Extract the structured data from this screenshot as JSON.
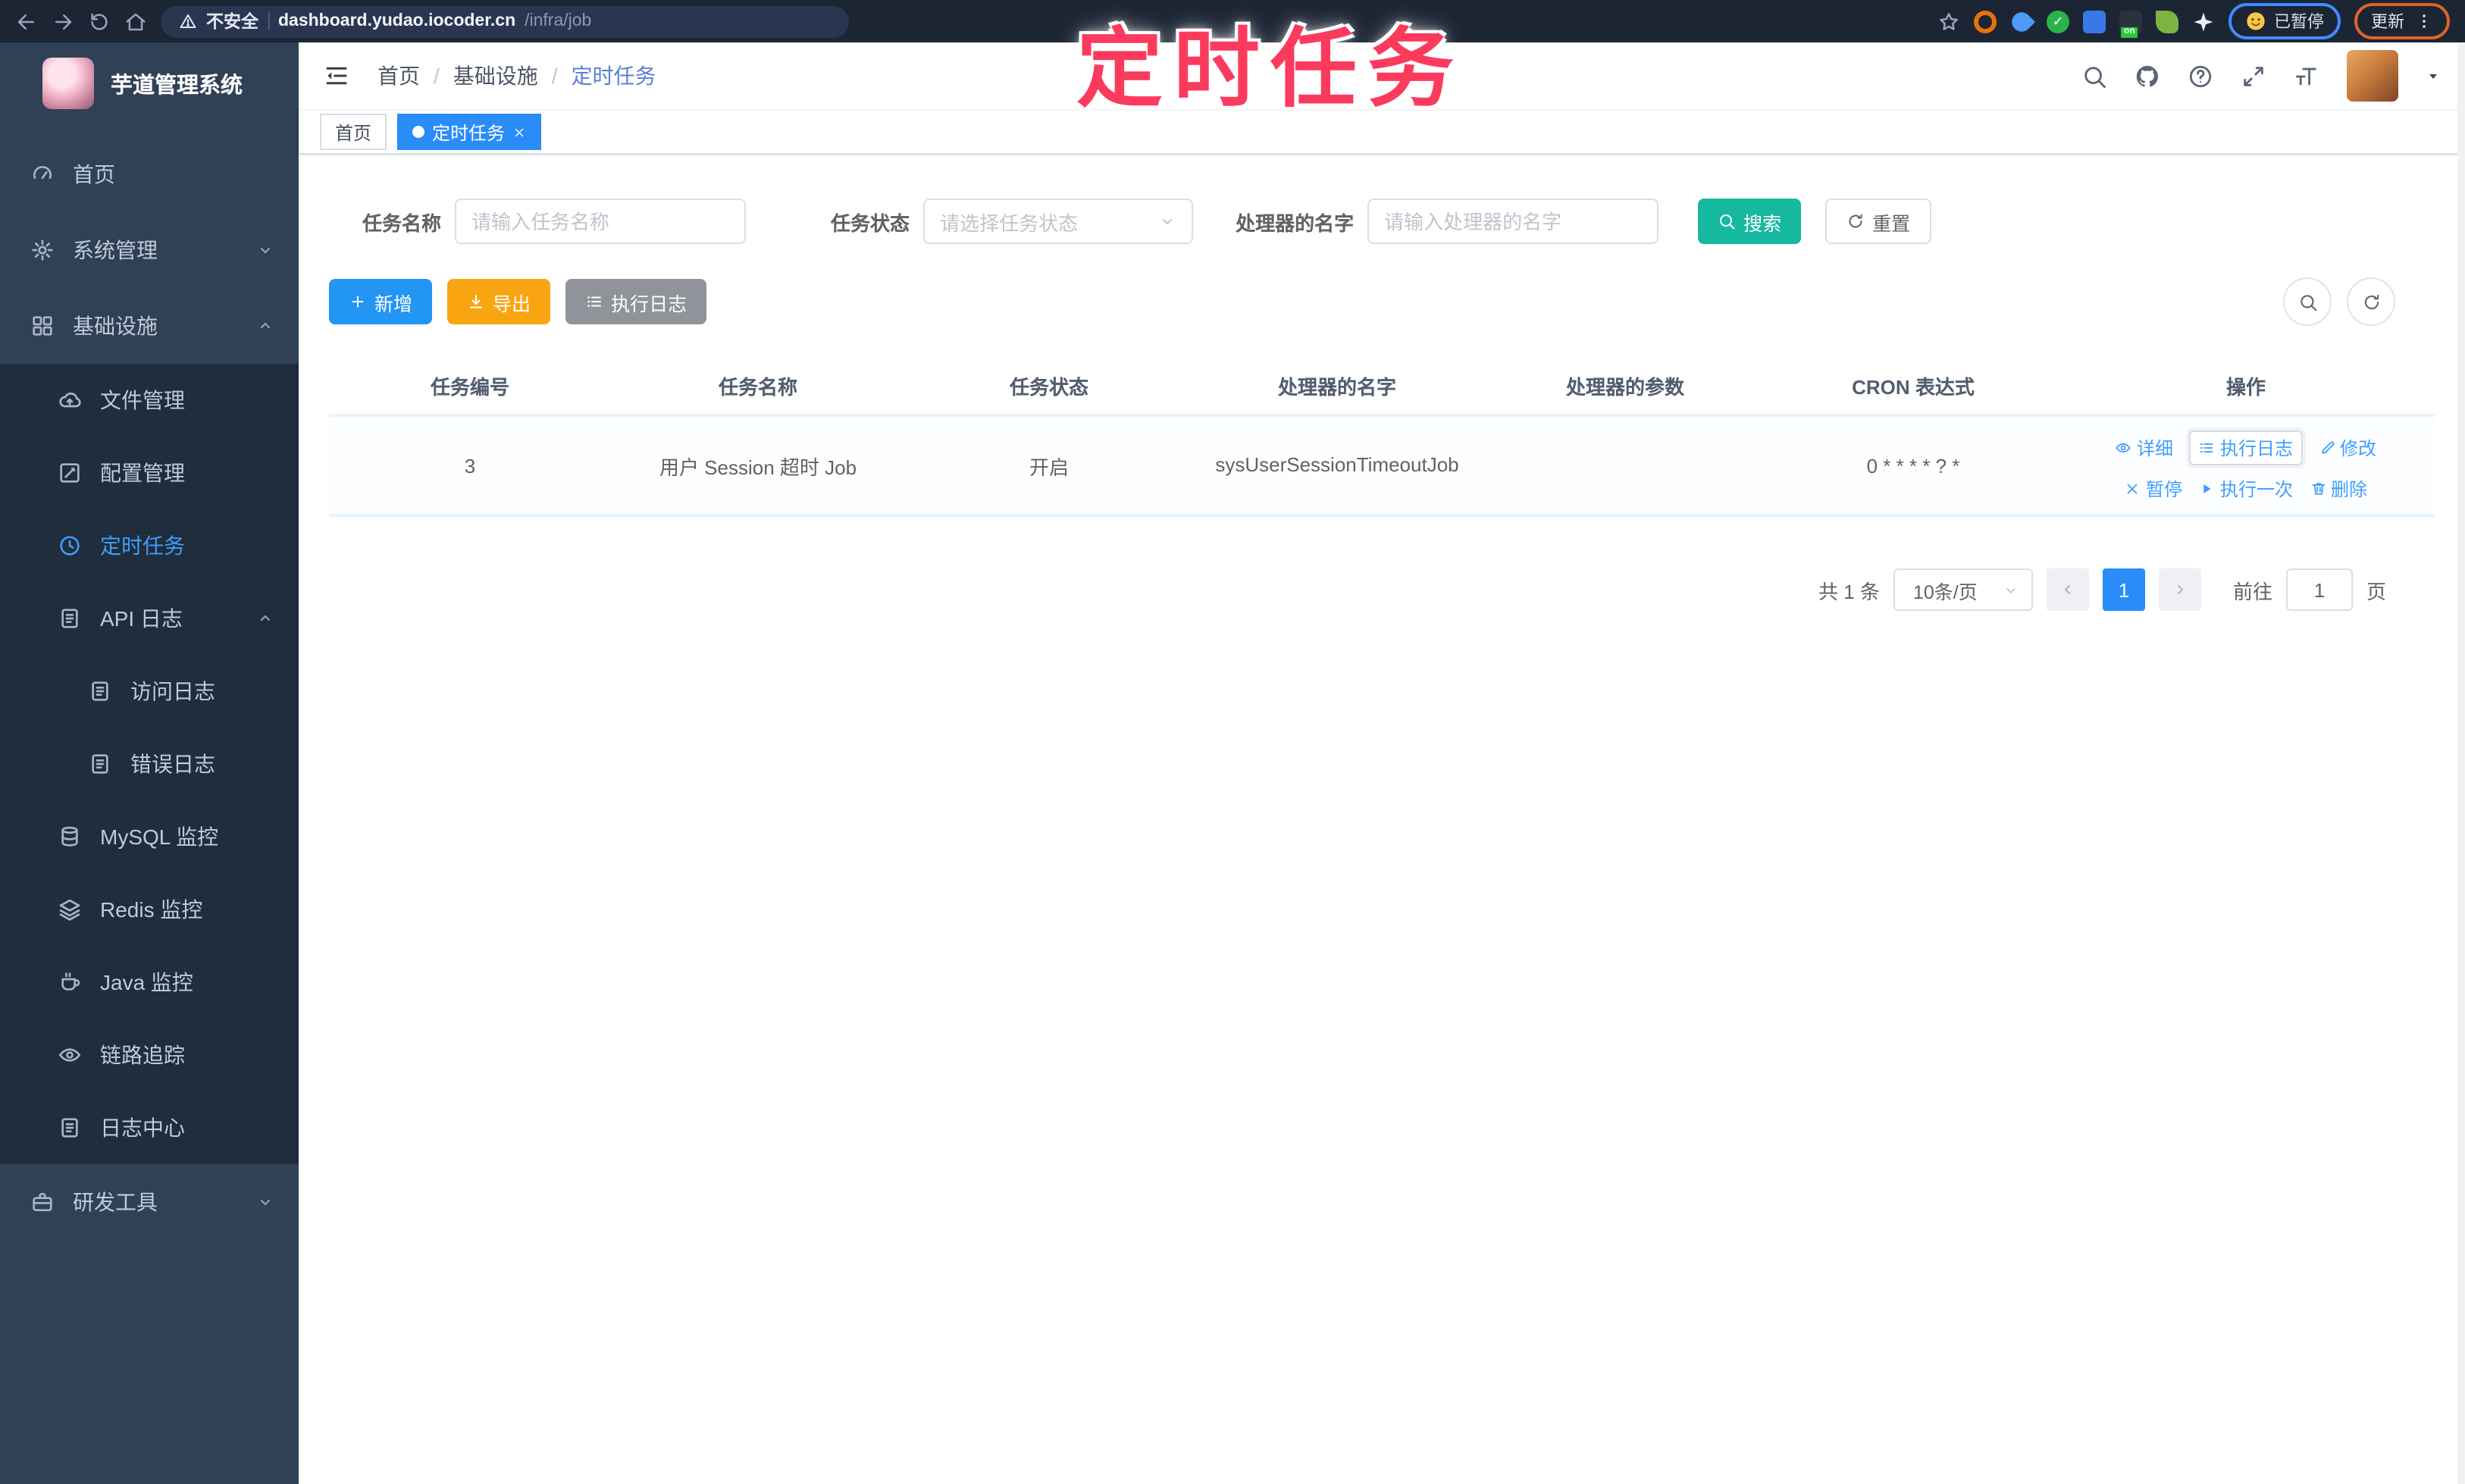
{
  "browser": {
    "security_label": "不安全",
    "url_host": "dashboard.yudao.iocoder.cn",
    "url_path": "/infra/job",
    "profile_chip_label": "已暂停",
    "update_chip_label": "更新",
    "nav_icons": [
      "back-icon",
      "forward-icon",
      "reload-icon",
      "home-icon"
    ],
    "extension_icons": [
      "bookmark-star-icon",
      "orange-donut-extension",
      "blue-drop-extension",
      "green-check-extension",
      "blue-grid-extension",
      "dark-on-extension",
      "leaf-extension",
      "white-star-extension",
      "emoji-profile-icon",
      "menu-dots-icon"
    ]
  },
  "watermark": "定时任务",
  "sidebar": {
    "title": "芋道管理系统",
    "items": [
      {
        "label": "首页",
        "icon": "gauge",
        "level": 1
      },
      {
        "label": "系统管理",
        "icon": "gear",
        "level": 1,
        "chevron": "down"
      },
      {
        "label": "基础设施",
        "icon": "grid",
        "level": 1,
        "chevron": "up"
      },
      {
        "label": "文件管理",
        "icon": "cloud",
        "level": 2
      },
      {
        "label": "配置管理",
        "icon": "editsq",
        "level": 2
      },
      {
        "label": "定时任务",
        "icon": "clock",
        "level": 2,
        "active": true
      },
      {
        "label": "API 日志",
        "icon": "doc",
        "level": 2,
        "chevron": "up"
      },
      {
        "label": "访问日志",
        "icon": "doc",
        "level": 3
      },
      {
        "label": "错误日志",
        "icon": "doc",
        "level": 3
      },
      {
        "label": "MySQL 监控",
        "icon": "db",
        "level": 2
      },
      {
        "label": "Redis 监控",
        "icon": "layers",
        "level": 2
      },
      {
        "label": "Java 监控",
        "icon": "coffee",
        "level": 2
      },
      {
        "label": "链路追踪",
        "icon": "eye",
        "level": 2
      },
      {
        "label": "日志中心",
        "icon": "doc",
        "level": 2
      },
      {
        "label": "研发工具",
        "icon": "briefcase",
        "level": 1,
        "chevron": "down"
      }
    ]
  },
  "header": {
    "breadcrumbs": [
      "首页",
      "基础设施",
      "定时任务"
    ],
    "separator": "/",
    "right_icons": [
      "search-icon",
      "github-icon",
      "help-icon",
      "fullscreen-icon",
      "text-size-icon",
      "avatar",
      "caret-down-icon"
    ]
  },
  "tabs": [
    {
      "label": "首页",
      "active": false
    },
    {
      "label": "定时任务",
      "active": true,
      "closable": true
    }
  ],
  "filters": {
    "name_label": "任务名称",
    "name_placeholder": "请输入任务名称",
    "status_label": "任务状态",
    "status_placeholder": "请选择任务状态",
    "handler_label": "处理器的名字",
    "handler_placeholder": "请输入处理器的名字",
    "search_label": "搜索",
    "reset_label": "重置"
  },
  "toolbar": {
    "add_label": "新增",
    "export_label": "导出",
    "exec_log_label": "执行日志",
    "icon_buttons": [
      "show-search-icon",
      "refresh-icon"
    ]
  },
  "table": {
    "columns": [
      "任务编号",
      "任务名称",
      "任务状态",
      "处理器的名字",
      "处理器的参数",
      "CRON 表达式",
      "操作"
    ],
    "rows": [
      {
        "id": "3",
        "name": "用户 Session 超时 Job",
        "status": "开启",
        "handler": "sysUserSessionTimeoutJob",
        "param": "",
        "cron": "0 * * * * ? *",
        "actions_row1": [
          {
            "icon": "eye",
            "label": "详细"
          },
          {
            "icon": "list",
            "label": "执行日志",
            "focused": true
          },
          {
            "icon": "pencil",
            "label": "修改"
          }
        ],
        "actions_row2": [
          {
            "icon": "close",
            "label": "暂停"
          },
          {
            "icon": "play",
            "label": "执行一次"
          },
          {
            "icon": "trash",
            "label": "删除"
          }
        ]
      }
    ]
  },
  "pagination": {
    "total_label": "共 1 条",
    "page_size": "10条/页",
    "current_page": "1",
    "goto_label": "前往",
    "goto_value": "1",
    "page_unit": "页"
  },
  "colors": {
    "accent": "#409EFF",
    "tag_active": "#2a8cf8",
    "search_button": "#17b8a0",
    "add_button": "#2395f2",
    "export_button": "#f9a511",
    "info_button": "#909399",
    "sidebar_bg": "#304156",
    "submenu_bg": "#1f2d3d",
    "sidebar_text": "#bfcbd9",
    "watermark": "#fb3b5e",
    "browser_bar": "#1c2534"
  }
}
